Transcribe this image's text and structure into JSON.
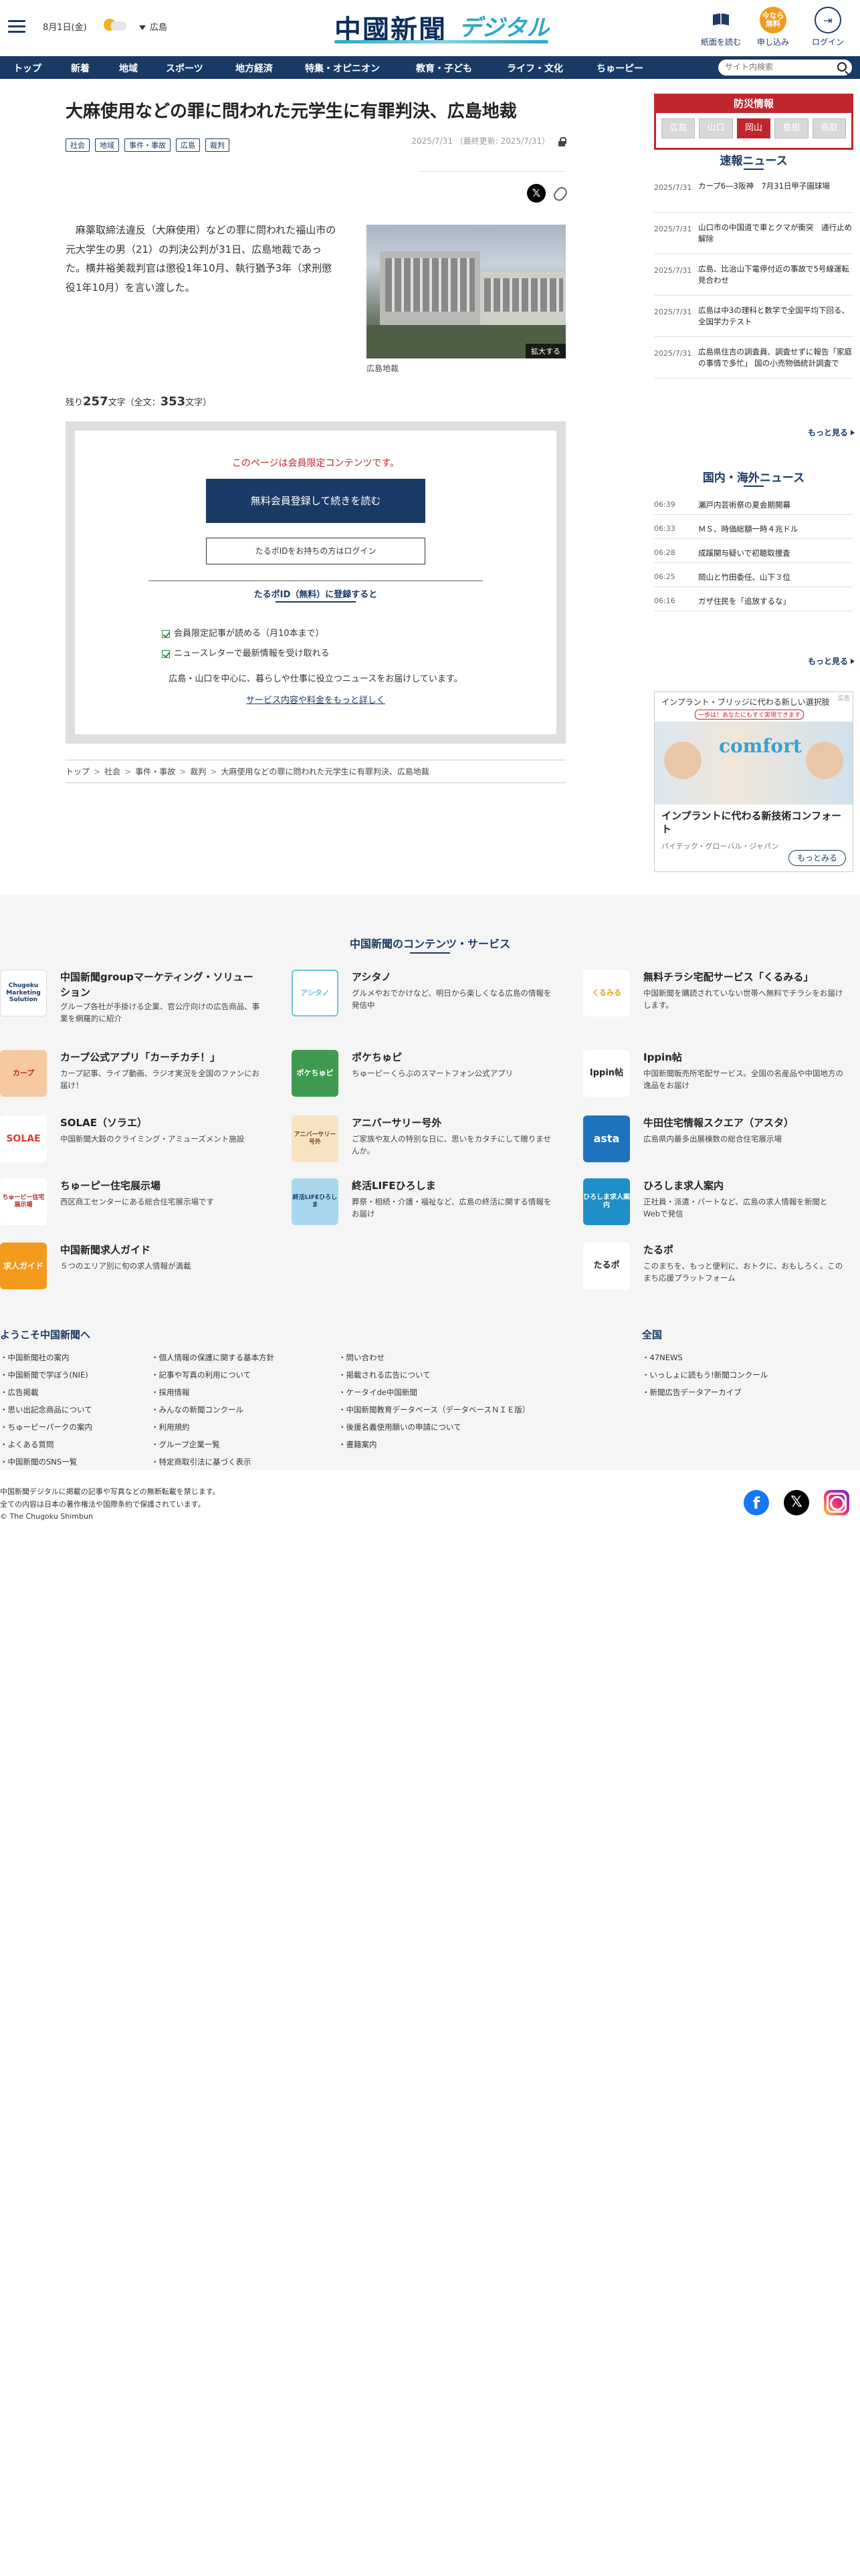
{
  "header": {
    "date": "8月1日(金)",
    "region": "広島",
    "logo_main": "中國新聞",
    "logo_sub": "デジタル",
    "btn_read_paper": "紙面を読む",
    "btn_apply": "申し込み",
    "btn_apply_icon_text": "今なら\n無料",
    "btn_login": "ログイン"
  },
  "nav": {
    "items": [
      "トップ",
      "新着",
      "地域",
      "スポーツ",
      "地方経済",
      "特集・オピニオン",
      "教育・子ども",
      "ライフ・文化",
      "ちゅーピー"
    ],
    "search_placeholder": "サイト内検索"
  },
  "article": {
    "headline": "大麻使用などの罪に問われた元学生に有罪判決、広島地裁",
    "tags": [
      "社会",
      "地域",
      "事件・事故",
      "広島",
      "裁判"
    ],
    "date": "2025/7/31",
    "updated": "（最終更新: 2025/7/31）",
    "lead": "　麻薬取締法違反（大麻使用）などの罪に問われた福山市の元大学生の男（21）の判決公判が31日、広島地裁であった。横井裕美裁判官は懲役1年10月、執行猶予3年（求刑懲役1年10月）を言い渡した。",
    "photo_enlarge": "拡大する",
    "photo_caption": "広島地裁",
    "remain_prefix": "残り",
    "remain_count": "257",
    "remain_mid": "文字（全文：",
    "total_count": "353",
    "remain_suffix": "文字）"
  },
  "paywall": {
    "title": "このページは会員限定コンテンツです。",
    "primary": "無料会員登録して続きを読む",
    "secondary": "たるポIDをお持ちの方はログイン",
    "register": "たるポID（無料）に登録すると",
    "benefit1": "会員限定記事が読める（月10本まで）",
    "benefit2": "ニュースレターで最新情報を受け取れる",
    "desc": "広島・山口を中心に、暮らしや仕事に役立つニュースをお届けしています。",
    "link": "サービス内容や料金をもっと詳しく"
  },
  "breadcrumb": [
    "トップ",
    "社会",
    "事件・事故",
    "裁判",
    "大麻使用などの罪に問われた元学生に有罪判決、広島地裁"
  ],
  "sidebar": {
    "bousai_title": "防災情報",
    "bousai_tabs": [
      "広島",
      "山口",
      "岡山",
      "島根",
      "鳥取"
    ],
    "bousai_active": "岡山",
    "breaking_title": "速報ニュース",
    "breaking": [
      {
        "date": "2025/7/31",
        "title": "カープ6―3阪神　7月31日甲子園球場"
      },
      {
        "date": "2025/7/31",
        "title": "山口市の中国道で車とクマが衝突　通行止め解除"
      },
      {
        "date": "2025/7/31",
        "title": "広島、比治山下電停付近の事故で5号線運転見合わせ"
      },
      {
        "date": "2025/7/31",
        "title": "広島は中3の理科と数学で全国平均下回る、全国学力テスト"
      },
      {
        "date": "2025/7/31",
        "title": "広島県住吉の調査員、調査せずに報告「家庭の事情で多忙」 国の小売物価統計調査で"
      }
    ],
    "more": "もっと見る",
    "intl_title": "国内・海外ニュース",
    "intl": [
      {
        "time": "06:39",
        "title": "瀬戸内芸術祭の夏会期開幕"
      },
      {
        "time": "06:33",
        "title": "ＭＳ、時価総額一時４兆ドル"
      },
      {
        "time": "06:28",
        "title": "成蹊関与疑いで初聴取捜査"
      },
      {
        "time": "06:25",
        "title": "岡山と竹田委任、山下３位"
      },
      {
        "time": "06:16",
        "title": "ガザ住民を「追放するな」"
      }
    ],
    "more2": "もっと見る",
    "ad_top": "インプラント・ブリッジに代わる新しい選択肢",
    "ad_sub": "一歩は！あなたにもすぐ実現できます",
    "ad_badge": "広告",
    "ad_logo": "comfort",
    "ad_title": "インプラントに代わる新技術コンフォート",
    "ad_corp": "パイテック・グローバル・ジャパン",
    "ad_btn": "もっとみる"
  },
  "services": {
    "title": "中国新聞のコンテンツ・サービス",
    "items": [
      {
        "icon_text": "Chugoku Marketing Solution",
        "name": "中国新聞groupマーケティング・ソリューション",
        "desc": "グループ各社が手掛ける企業、官公庁向けの広告商品、事業を網羅的に紹介"
      },
      {
        "icon_text": "アシタノ",
        "name": "アシタノ",
        "desc": "グルメやおでかけなど、明日から楽しくなる広島の情報を発信中"
      },
      {
        "icon_text": "くるみる",
        "name": "無料チラシ宅配サービス「くるみる」",
        "desc": "中国新聞を購読されていない世帯へ無料でチラシをお届けします。"
      },
      {
        "icon_text": "カープ",
        "name": "カープ公式アプリ「カーチカチ！」",
        "desc": "カープ記事、ライブ動画、ラジオ実況を全国のファンにお届け！"
      },
      {
        "icon_text": "ポケちゅピ",
        "name": "ポケちゅピ",
        "desc": "ちゅーピーくらぶのスマートフォン公式アプリ"
      },
      {
        "icon_text": "Ippin帖",
        "name": "Ippin帖",
        "desc": "中国新聞販売所宅配サービス。全国の名産品や中国地方の逸品をお届け"
      },
      {
        "icon_text": "SOLAE",
        "name": "SOLAE（ソラエ）",
        "desc": "中国新聞大穀のクライミング・アミューズメント施設"
      },
      {
        "icon_text": "アニバーサリー号外",
        "name": "アニバーサリー号外",
        "desc": "ご家族や友人の特別な日に、思いをカタチにして贈りませんか。"
      },
      {
        "icon_text": "asta",
        "name": "牛田住宅情報スクエア（アスタ）",
        "desc": "広島県内最多出展棟数の総合住宅展示場"
      },
      {
        "icon_text": "ちゅーピー住宅展示場",
        "name": "ちゅーピー住宅展示場",
        "desc": "西区商工センターにある総合住宅展示場です"
      },
      {
        "icon_text": "終活LIFEひろしま",
        "name": "終活LIFEひろしま",
        "desc": "葬祭・相続・介護・福祉など、広島の終活に関する情報をお届け"
      },
      {
        "icon_text": "ひろしま求人案内",
        "name": "ひろしま求人案内",
        "desc": "正社員・派遣・パートなど、広島の求人情報を新聞とWebで発信"
      },
      {
        "icon_text": "求人ガイド",
        "name": "中国新聞求人ガイド",
        "desc": "５つのエリア別に旬の求人情報が満載"
      },
      {
        "icon_text": "たるポ",
        "name": "たるポ",
        "desc": "このまちを、もっと便利に、おトクに、おもしろく。このまち応援プラットフォーム"
      }
    ]
  },
  "footer": {
    "welcome": "ようこそ中国新聞へ",
    "col1": [
      "中国新聞社の案内",
      "中国新聞で学ぼう(NIE)",
      "広告掲載",
      "思い出記念商品について",
      "ちゅーピーパークの案内",
      "よくある質問",
      "中国新聞のSNS一覧"
    ],
    "col2": [
      "個人情報の保護に関する基本方針",
      "記事や写真の利用について",
      "採用情報",
      "みんなの新聞コンクール",
      "利用規約",
      "グループ企業一覧",
      "特定商取引法に基づく表示"
    ],
    "col3": [
      "問い合わせ",
      "掲載される広告について",
      "ケータイde中国新聞",
      "中国新聞教育データベース（データベースＮＩＥ版）",
      "後援名義使用願いの申請について",
      "書籍案内"
    ],
    "zenkoku": "全国",
    "col4": [
      "47NEWS",
      "いっしょに読もう!新聞コンクール",
      "新聞広告データアーカイブ"
    ],
    "copy1": "中国新聞デジタルに掲載の記事や写真などの無断転載を禁じます。",
    "copy2": "全ての内容は日本の著作権法や国際条約で保護されています。",
    "copy3": "© The Chugoku Shimbun"
  },
  "colors": {
    "navy": "#1a3a66",
    "red": "#c0272d",
    "orange": "#f39a1d"
  }
}
